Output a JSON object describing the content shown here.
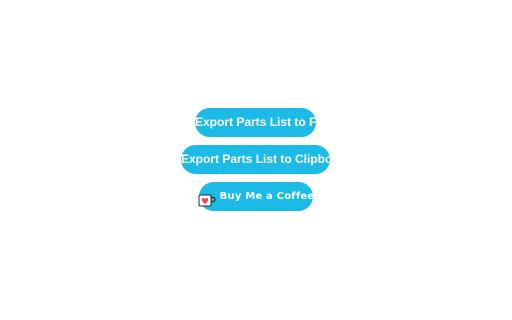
{
  "actions": {
    "export_file_label": "Export Parts List to File",
    "export_clipboard_label": "Export Parts List to Clipboard",
    "coffee_label": "Buy Me a Coffee",
    "coffee_icon": "coffee-cup-heart-icon"
  },
  "colors": {
    "button_background": "#1cbbe7",
    "button_text": "#ffffff",
    "heart": "#e8455a"
  }
}
